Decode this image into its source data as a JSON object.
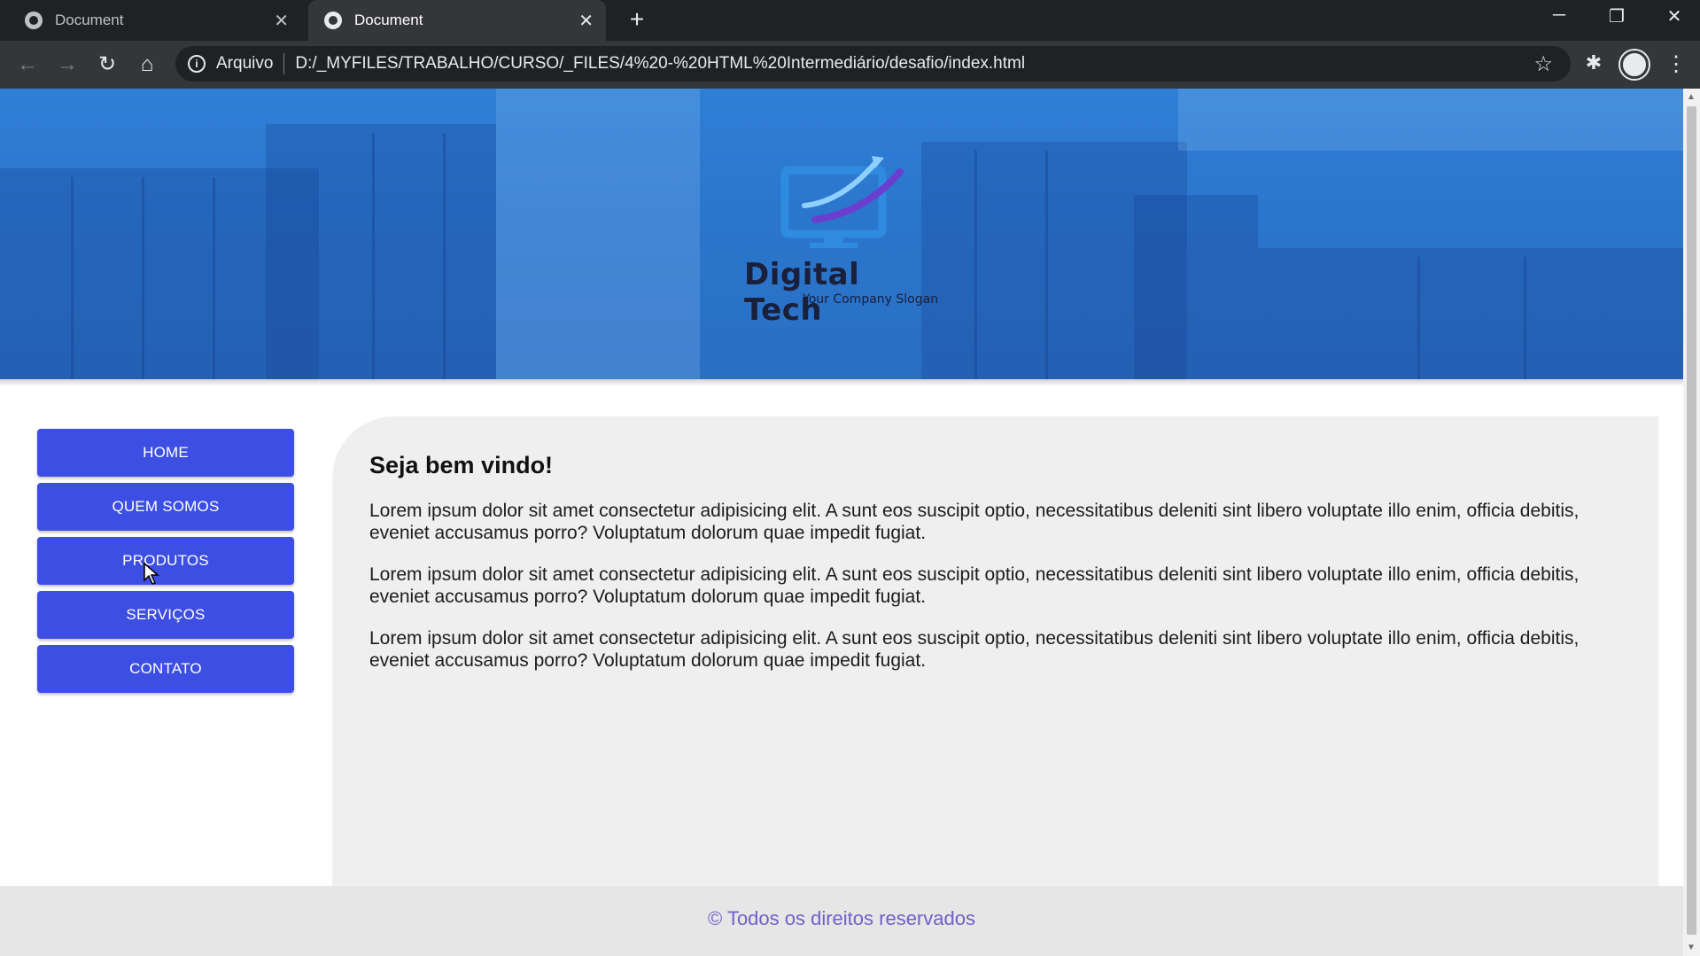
{
  "browser": {
    "tabs": [
      {
        "title": "Document",
        "active": false
      },
      {
        "title": "Document",
        "active": true
      }
    ],
    "new_tab_symbol": "+",
    "window_controls": {
      "minimize": "─",
      "restore": "❐",
      "close": "✕"
    },
    "nav": {
      "back": "←",
      "forward": "→",
      "reload": "↻",
      "home": "⌂"
    },
    "address": {
      "scheme_label": "Arquivo",
      "url": "D:/_MYFILES/TRABALHO/CURSO/_FILES/4%20-%20HTML%20Intermediário/desafio/index.html"
    },
    "icons": {
      "info": "info-icon",
      "bookmark": "star-icon",
      "extensions": "puzzle-icon",
      "profile": "avatar-icon",
      "menu": "kebab-menu-icon"
    }
  },
  "header": {
    "brand": "Digital Tech",
    "slogan": "Your Company Slogan",
    "colors": {
      "banner": "#2a76cc",
      "logo_arc": "#6a3fd0",
      "logo_monitor": "#2f8be0"
    }
  },
  "sidebar": {
    "items": [
      {
        "label": "HOME"
      },
      {
        "label": "QUEM SOMOS"
      },
      {
        "label": "PRODUTOS"
      },
      {
        "label": "SERVIÇOS"
      },
      {
        "label": "CONTATO"
      }
    ],
    "color": "#3d4ee3"
  },
  "main": {
    "heading": "Seja bem vindo!",
    "paragraphs": [
      "Lorem ipsum dolor sit amet consectetur adipisicing elit. A sunt eos suscipit optio, necessitatibus deleniti sint libero voluptate illo enim, officia debitis, eveniet accusamus porro? Voluptatum dolorum quae impedit fugiat.",
      "Lorem ipsum dolor sit amet consectetur adipisicing elit. A sunt eos suscipit optio, necessitatibus deleniti sint libero voluptate illo enim, officia debitis, eveniet accusamus porro? Voluptatum dolorum quae impedit fugiat.",
      "Lorem ipsum dolor sit amet consectetur adipisicing elit. A sunt eos suscipit optio, necessitatibus deleniti sint libero voluptate illo enim, officia debitis, eveniet accusamus porro? Voluptatum dolorum quae impedit fugiat."
    ]
  },
  "footer": {
    "copyright": "© Todos os direitos reservados",
    "color": "#7060c8"
  }
}
